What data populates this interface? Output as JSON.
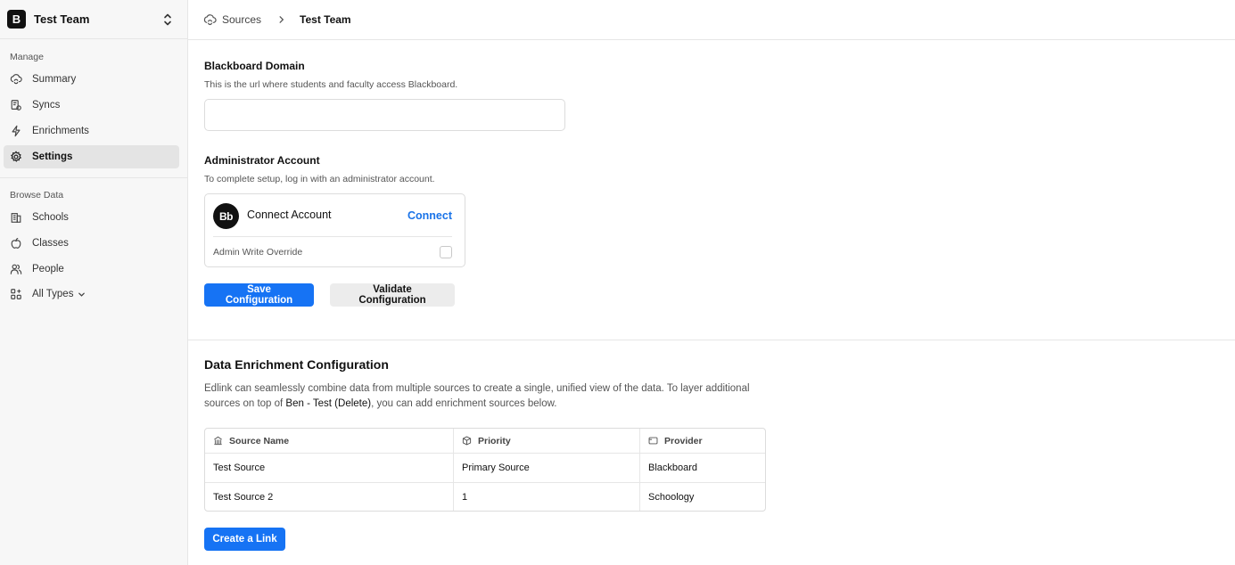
{
  "sidebar": {
    "team": {
      "logo_letter": "B",
      "name": "Test Team"
    },
    "manage_label": "Manage",
    "manage_items": [
      {
        "label": "Summary",
        "icon": "cloud-sync-icon"
      },
      {
        "label": "Syncs",
        "icon": "sync-icon"
      },
      {
        "label": "Enrichments",
        "icon": "bolt-icon"
      },
      {
        "label": "Settings",
        "icon": "gear-icon",
        "active": true
      }
    ],
    "browse_label": "Browse Data",
    "browse_items": [
      {
        "label": "Schools",
        "icon": "building-icon"
      },
      {
        "label": "Classes",
        "icon": "apple-icon"
      },
      {
        "label": "People",
        "icon": "people-icon"
      },
      {
        "label": "All Types",
        "icon": "grid-icon"
      }
    ]
  },
  "header": {
    "crumb_sources": "Sources",
    "crumb_current": "Test Team"
  },
  "config": {
    "domain_label": "Blackboard Domain",
    "domain_desc": "This is the url where students and faculty access Blackboard.",
    "domain_value": "",
    "admin_label": "Administrator Account",
    "admin_desc": "To complete setup, log in with an administrator account.",
    "account": {
      "logo_text": "Bb",
      "title": "Connect Account",
      "connect_label": "Connect",
      "override_label": "Admin Write Override"
    },
    "save_label": "Save Configuration",
    "validate_label": "Validate Configuration"
  },
  "enrichment": {
    "title": "Data Enrichment Configuration",
    "desc_part1": "Edlink can seamlessly combine data from multiple sources to create a single, unified view of the data. To layer additional sources on top of ",
    "desc_source": "Ben - Test (Delete)",
    "desc_part2": ", you can add enrichment sources below.",
    "table": {
      "headers": [
        "Source Name",
        "Priority",
        "Provider"
      ],
      "rows": [
        [
          "Test Source",
          "Primary Source",
          "Blackboard"
        ],
        [
          "Test Source 2",
          "1",
          "Schoology"
        ]
      ]
    },
    "create_link_label": "Create a Link"
  }
}
